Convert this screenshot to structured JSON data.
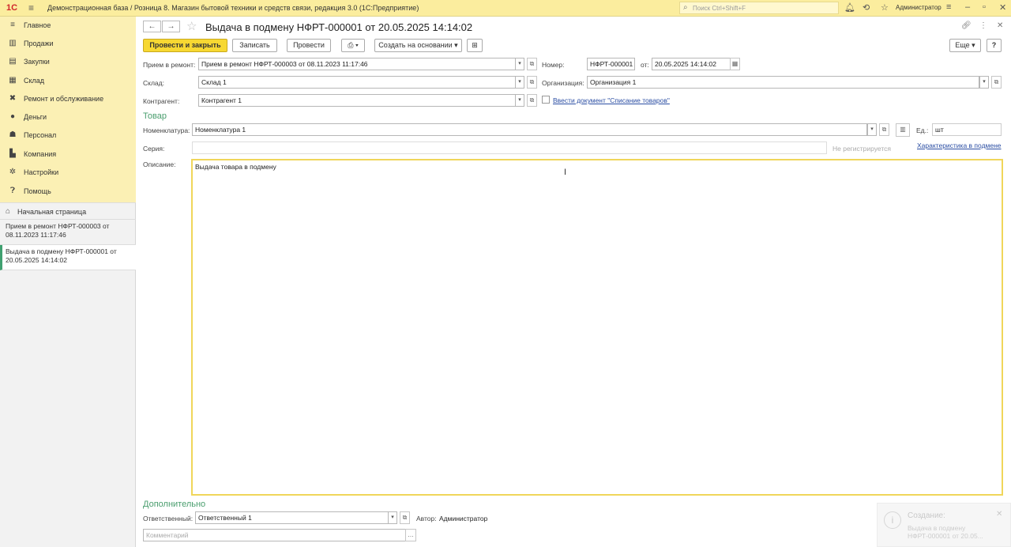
{
  "app": {
    "logo": "1С",
    "title": "Демонстрационная база / Розница 8. Магазин бытовой техники и средств связи, редакция 3.0  (1С:Предприятие)",
    "search_placeholder": "Поиск Ctrl+Shift+F",
    "user": "Администратор"
  },
  "sidebar": {
    "items": [
      {
        "label": "Главное",
        "icon": "menu-icon"
      },
      {
        "label": "Продажи",
        "icon": "sales-icon"
      },
      {
        "label": "Закупки",
        "icon": "purchases-icon"
      },
      {
        "label": "Склад",
        "icon": "warehouse-icon"
      },
      {
        "label": "Ремонт и обслуживание",
        "icon": "wrench-icon"
      },
      {
        "label": "Деньги",
        "icon": "money-icon"
      },
      {
        "label": "Персонал",
        "icon": "staff-icon"
      },
      {
        "label": "Компания",
        "icon": "company-icon"
      },
      {
        "label": "Настройки",
        "icon": "settings-icon"
      },
      {
        "label": "Помощь",
        "icon": "help-icon"
      }
    ],
    "home": "Начальная страница",
    "open_windows": [
      "Прием в ремонт НФРТ-000003 от 08.11.2023 11:17:46",
      "Выдача в подмену НФРТ-000001 от 20.05.2025 14:14:02"
    ]
  },
  "document": {
    "title": "Выдача в подмену НФРТ-000001 от 20.05.2025 14:14:02",
    "buttons": {
      "post_close": "Провести и закрыть",
      "save": "Записать",
      "post": "Провести",
      "create_based": "Создать на основании",
      "more": "Еще",
      "help": "?"
    },
    "fields": {
      "repair_label": "Прием в ремонт:",
      "repair_value": "Прием в ремонт НФРТ-000003 от 08.11.2023 11:17:46",
      "number_label": "Номер:",
      "number_value": "НФРТ-000001",
      "date_label": "от:",
      "date_value": "20.05.2025 14:14:02",
      "warehouse_label": "Склад:",
      "warehouse_value": "Склад 1",
      "org_label": "Организация:",
      "org_value": "Организация 1",
      "contractor_label": "Контрагент:",
      "contractor_value": "Контрагент 1",
      "writeoff_link": "Ввести документ \"Списание товаров\""
    },
    "goods": {
      "section": "Товар",
      "nomenclature_label": "Номенклатура:",
      "nomenclature_value": "Номенклатура 1",
      "unit_label": "Ед.:",
      "unit_value": "шт",
      "series_label": "Серия:",
      "series_note": "Не регистрируется",
      "characteristic_link": "Характеристика в подмене",
      "description_label": "Описание:",
      "description_value": "Выдача товара в подмену"
    },
    "extra": {
      "section": "Дополнительно",
      "responsible_label": "Ответственный:",
      "responsible_value": "Ответственный 1",
      "author_label": "Автор:",
      "author_value": "Администратор",
      "comment_placeholder": "Комментарий"
    }
  },
  "notification": {
    "title": "Создание:",
    "text": "Выдача в подмену НФРТ-000001 от 20.05..."
  }
}
